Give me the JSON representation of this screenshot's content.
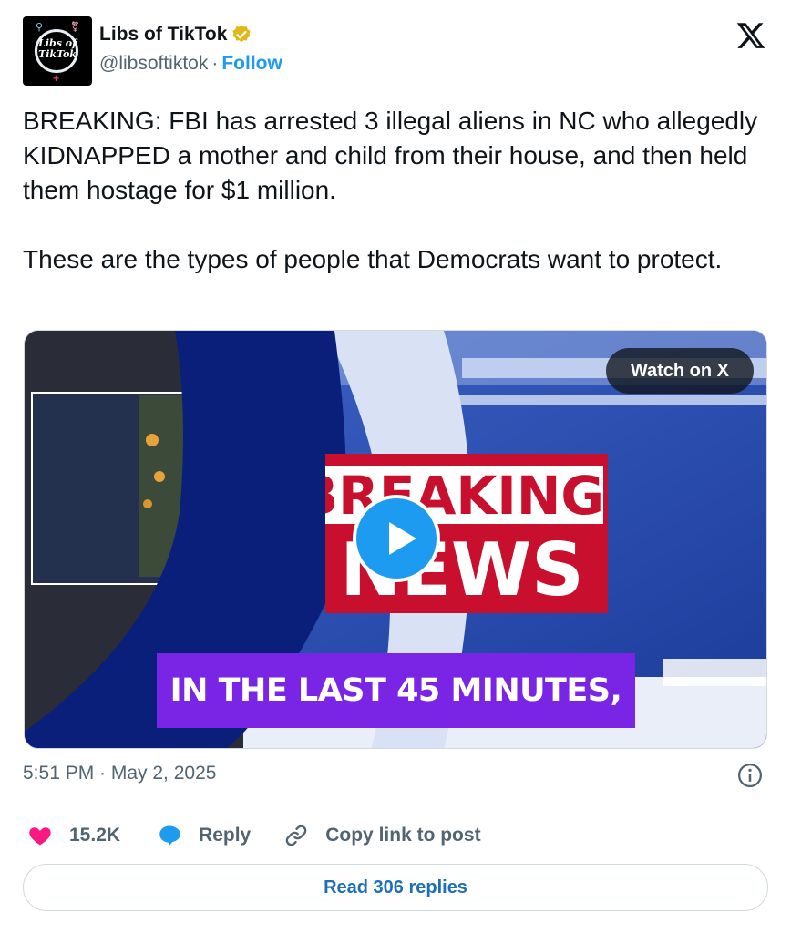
{
  "author": {
    "avatar_text_line1": "Libs of",
    "avatar_text_line2": "TikTok",
    "display_name": "Libs of TikTok",
    "handle": "@libsoftiktok",
    "separator": "·",
    "follow_label": "Follow",
    "verified_icon": "verified-gold-badge-icon"
  },
  "platform_icon": "x-logo-icon",
  "tweet": {
    "paragraph1": "BREAKING: FBI has arrested 3 illegal aliens in NC who allegedly KIDNAPPED a mother and child from their house, and then held them hostage for $1 million.",
    "paragraph2": "These are the types of people that Democrats want to protect."
  },
  "media": {
    "watch_label": "Watch on X",
    "banner_line1": "BREAKING",
    "banner_line2": "NEWS",
    "caption": "IN THE LAST 45 MINUTES,",
    "play_icon": "play-icon"
  },
  "meta": {
    "timestamp": "5:51 PM · May 2, 2025",
    "info_icon": "info-icon"
  },
  "actions": {
    "like_count": "15.2K",
    "reply_label": "Reply",
    "copy_label": "Copy link to post"
  },
  "read_replies_label": "Read 306 replies",
  "colors": {
    "accent": "#1d9bf0",
    "like": "#f91880",
    "caption_bg": "#7a25e6",
    "banner_red": "#c8102e"
  }
}
